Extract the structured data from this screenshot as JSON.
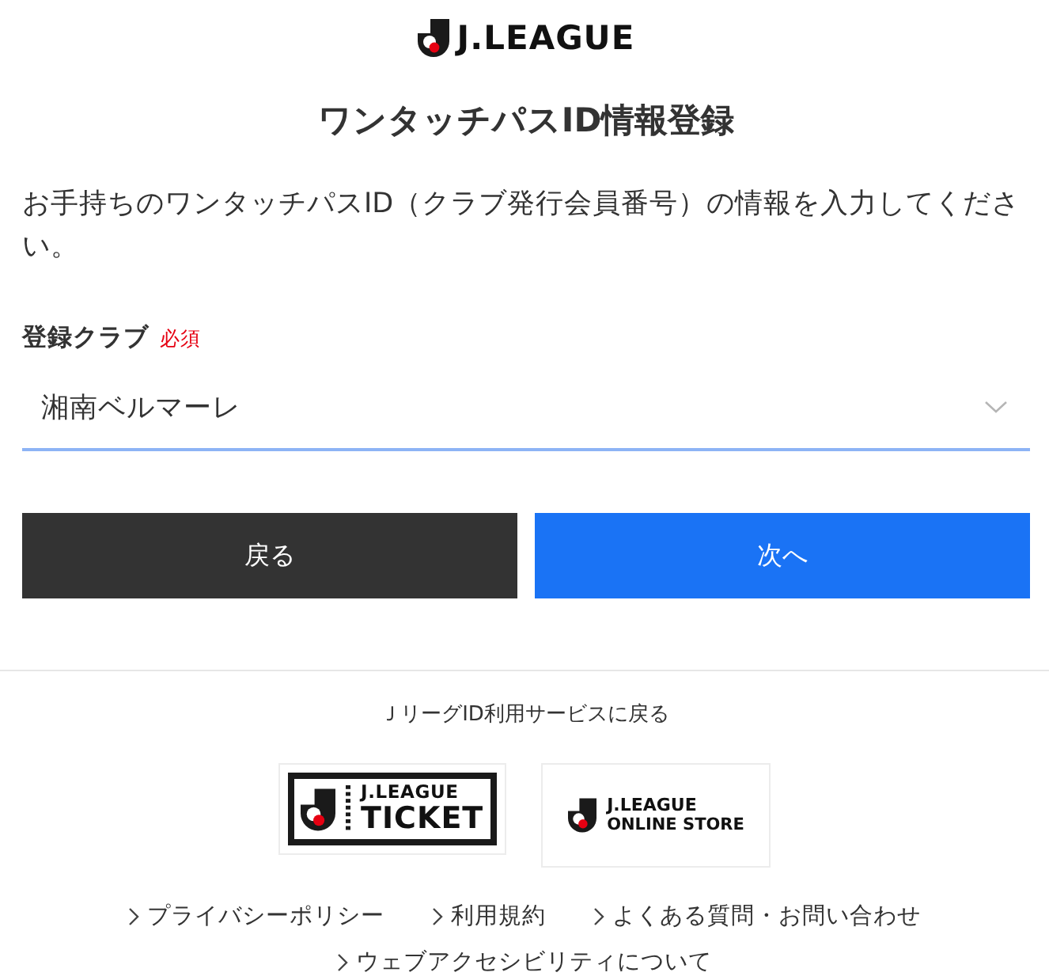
{
  "header": {
    "logo_text": "J.LEAGUE"
  },
  "title": "ワンタッチパスID情報登録",
  "description": "お手持ちのワンタッチパスID（クラブ発行会員番号）の情報を入力してください。",
  "form": {
    "label": "登録クラブ",
    "required_badge": "必須",
    "club_select": {
      "value": "湘南ベルマーレ"
    }
  },
  "buttons": [
    {
      "label": "戻る",
      "kind": "secondary"
    },
    {
      "label": "次へ",
      "kind": "primary"
    }
  ],
  "footer": {
    "back_link": "ＪリーグID利用サービスに戻る",
    "banners": [
      {
        "kind": "ticket",
        "lines": [
          "J.LEAGUE",
          "TICKET"
        ]
      },
      {
        "kind": "store",
        "lines": [
          "J.LEAGUE",
          "ONLINE STORE"
        ]
      }
    ],
    "links": [
      "プライバシーポリシー",
      "利用規約",
      "よくある質問・お問い合わせ",
      "ウェブアクセシビリティについて"
    ]
  }
}
